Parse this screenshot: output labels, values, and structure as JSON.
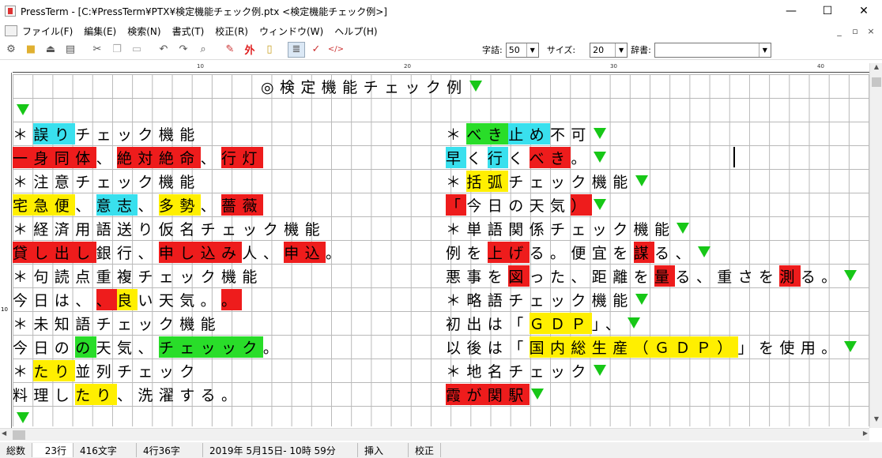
{
  "window": {
    "app_name": "PressTerm",
    "title": "PressTerm - [C:¥PressTerm¥PTX¥検定機能チェック例.ptx <検定機能チェック例>]",
    "minimize": "—",
    "maximize": "☐",
    "close": "✕"
  },
  "menu": {
    "items": [
      "ファイル(F)",
      "編集(E)",
      "検索(N)",
      "書式(T)",
      "校正(R)",
      "ウィンドウ(W)",
      "ヘルプ(H)"
    ],
    "mdi_min": "_",
    "mdi_restore": "▫",
    "mdi_close": "×"
  },
  "toolbar": {
    "icons": [
      "settings-icon",
      "open-folder-icon",
      "import-icon",
      "print-icon",
      "cut-icon",
      "copy-icon",
      "paste-icon",
      "undo-icon",
      "redo-icon",
      "search-icon",
      "eraser-icon",
      "foreign-char-icon",
      "memo-icon",
      "vertical-text-icon",
      "check-icon",
      "tag-icon"
    ],
    "foreign_glyph": "外",
    "char_count_label": "字詰:",
    "char_count_value": "50",
    "size_label": "サイズ:",
    "size_value": "20",
    "dict_label": "辞書:",
    "dict_value": ""
  },
  "ruler": {
    "ticks": [
      "10",
      "20",
      "30",
      "40"
    ]
  },
  "vruler": {
    "label": "10"
  },
  "document": {
    "title": "◎検定機能チェック例",
    "left": [
      [
        {
          "text": "＊"
        },
        {
          "text": "誤り",
          "hl": "cyan"
        },
        {
          "text": "チェック機能"
        }
      ],
      [
        {
          "text": "一身同体",
          "hl": "red"
        },
        {
          "text": "、"
        },
        {
          "text": "絶対絶命",
          "hl": "red"
        },
        {
          "text": "、"
        },
        {
          "text": "行灯",
          "hl": "red"
        }
      ],
      [
        {
          "text": "＊注意チェック機能"
        }
      ],
      [
        {
          "text": "宅急便",
          "hl": "yel"
        },
        {
          "text": "、"
        },
        {
          "text": "意志",
          "hl": "cyan"
        },
        {
          "text": "、"
        },
        {
          "text": "多勢",
          "hl": "yel"
        },
        {
          "text": "、"
        },
        {
          "text": "薔薇",
          "hl": "red"
        }
      ],
      [
        {
          "text": "＊経済用語送り仮名チェック機能"
        }
      ],
      [
        {
          "text": "貸し出し",
          "hl": "red"
        },
        {
          "text": "銀行、"
        },
        {
          "text": "申し込み",
          "hl": "red"
        },
        {
          "text": "人、"
        },
        {
          "text": "申込",
          "hl": "red"
        },
        {
          "text": "。"
        }
      ],
      [
        {
          "text": "＊句読点重複チェック機能"
        }
      ],
      [
        {
          "text": "今日は、"
        },
        {
          "text": "、",
          "hl": "red"
        },
        {
          "text": "良",
          "hl": "yel"
        },
        {
          "text": "い天気。"
        },
        {
          "text": "。",
          "hl": "red"
        }
      ],
      [
        {
          "text": "＊未知語チェック機能"
        }
      ],
      [
        {
          "text": "今日の"
        },
        {
          "text": "の",
          "hl": "grn"
        },
        {
          "text": "天気、"
        },
        {
          "text": "チェッック",
          "hl": "grn"
        },
        {
          "text": "。"
        }
      ],
      [
        {
          "text": "＊"
        },
        {
          "text": "たり",
          "hl": "yel"
        },
        {
          "text": "並列チェック"
        }
      ],
      [
        {
          "text": "料理し"
        },
        {
          "text": "たり",
          "hl": "yel"
        },
        {
          "text": "、洗濯する。"
        }
      ]
    ],
    "right": [
      [
        {
          "text": "＊"
        },
        {
          "text": "べき",
          "hl": "grn"
        },
        {
          "text": "止め",
          "hl": "cyan"
        },
        {
          "text": "不可"
        }
      ],
      [
        {
          "text": "早",
          "hl": "cyan"
        },
        {
          "text": "く"
        },
        {
          "text": "行",
          "hl": "cyan"
        },
        {
          "text": "く"
        },
        {
          "text": "べき",
          "hl": "red"
        },
        {
          "text": "。"
        }
      ],
      [
        {
          "text": "＊"
        },
        {
          "text": "括弧",
          "hl": "yel"
        },
        {
          "text": "チェック機能"
        }
      ],
      [
        {
          "text": "「",
          "hl": "red"
        },
        {
          "text": "今日の天気"
        },
        {
          "text": "）",
          "hl": "red"
        }
      ],
      [
        {
          "text": "＊単語関係チェック機能"
        }
      ],
      [
        {
          "text": "例を"
        },
        {
          "text": "上げ",
          "hl": "red"
        },
        {
          "text": "る。便宜を"
        },
        {
          "text": "謀",
          "hl": "red"
        },
        {
          "text": "る、"
        }
      ],
      [
        {
          "text": "悪事を"
        },
        {
          "text": "図",
          "hl": "red"
        },
        {
          "text": "った、距離を"
        },
        {
          "text": "量",
          "hl": "red"
        },
        {
          "text": "る、重さを"
        },
        {
          "text": "測",
          "hl": "red"
        },
        {
          "text": "る。"
        }
      ],
      [
        {
          "text": "＊略語チェック機能"
        }
      ],
      [
        {
          "text": "初出は「"
        },
        {
          "text": "ＧＤＰ",
          "hl": "yel"
        },
        {
          "text": "」、"
        }
      ],
      [
        {
          "text": "以後は「"
        },
        {
          "text": "国内総生産（ＧＤＰ）",
          "hl": "yel"
        },
        {
          "text": "」を使用。"
        }
      ],
      [
        {
          "text": "＊地名チェック"
        }
      ],
      [
        {
          "text": "霞が関駅",
          "hl": "red"
        }
      ]
    ]
  },
  "status": {
    "total_label": "総数",
    "lines": "23行",
    "chars": "416文字",
    "position": "4行36字",
    "datetime": "2019年 5月15日- 10時 59分",
    "mode": "挿入",
    "proof": "校正"
  }
}
